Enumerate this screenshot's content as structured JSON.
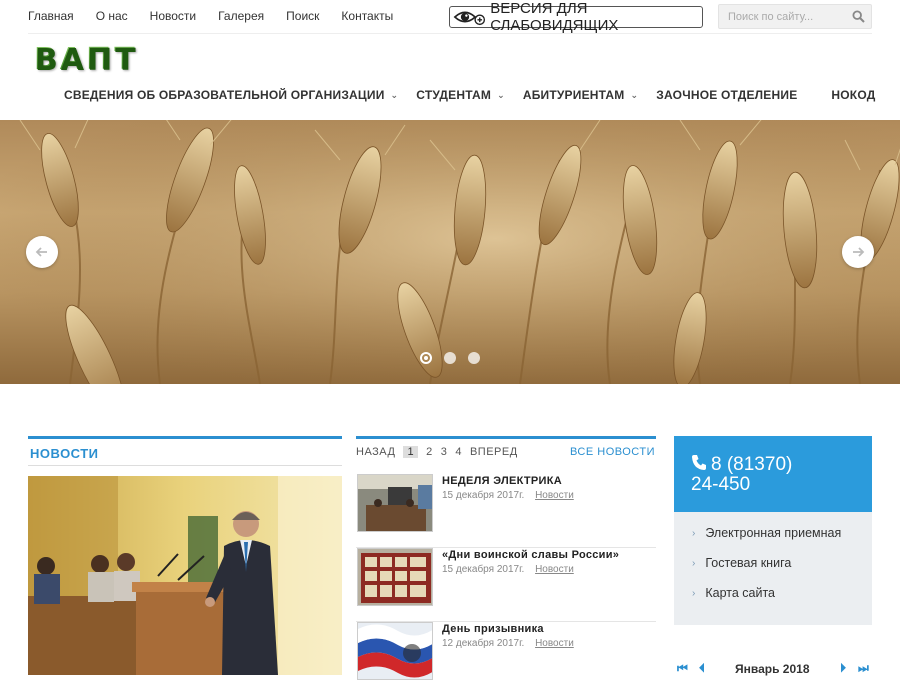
{
  "top_links": [
    "Главная",
    "О нас",
    "Новости",
    "Галерея",
    "Поиск",
    "Контакты"
  ],
  "vision_label": "ВЕРСИЯ ДЛЯ СЛАБОВИДЯЩИХ",
  "search": {
    "placeholder": "Поиск по сайту..."
  },
  "logo": "ВАПТ",
  "nav": [
    {
      "label": "СВЕДЕНИЯ ОБ ОБРАЗОВАТЕЛЬНОЙ ОРГАНИЗАЦИИ",
      "dropdown": true
    },
    {
      "label": "СТУДЕНТАМ",
      "dropdown": true
    },
    {
      "label": "АБИТУРИЕНТАМ",
      "dropdown": true
    },
    {
      "label": "ЗАОЧНОЕ ОТДЕЛЕНИЕ",
      "dropdown": false
    },
    {
      "label": "НОКОД",
      "dropdown": false
    }
  ],
  "slider": {
    "slides": 3,
    "active": 1
  },
  "news": {
    "heading": "НОВОСТИ",
    "prev": "НАЗАД",
    "pages": [
      "1",
      "2",
      "3",
      "4"
    ],
    "current_page": "1",
    "next": "ВПЕРЕД",
    "all": "ВСЕ НОВОСТИ",
    "items": [
      {
        "title": "НЕДЕЛЯ ЭЛЕКТРИКА",
        "date": "15 декабря 2017г.",
        "category": "Новости"
      },
      {
        "title": "«Дни воинской славы России»",
        "date": "15 декабря 2017г.",
        "category": "Новости"
      },
      {
        "title": "День призывника",
        "date": "12 декабря 2017г.",
        "category": "Новости"
      }
    ]
  },
  "contact": {
    "phone_line1": "8 (81370)",
    "phone_line2": "24-450",
    "links": [
      "Электронная приемная",
      "Гостевая книга",
      "Карта сайта"
    ]
  },
  "calendar": {
    "title": "Январь 2018"
  },
  "colors": {
    "accent": "#2b8fd0",
    "phone_bg": "#2b9bdc",
    "logo_green": "#3a8a24"
  }
}
